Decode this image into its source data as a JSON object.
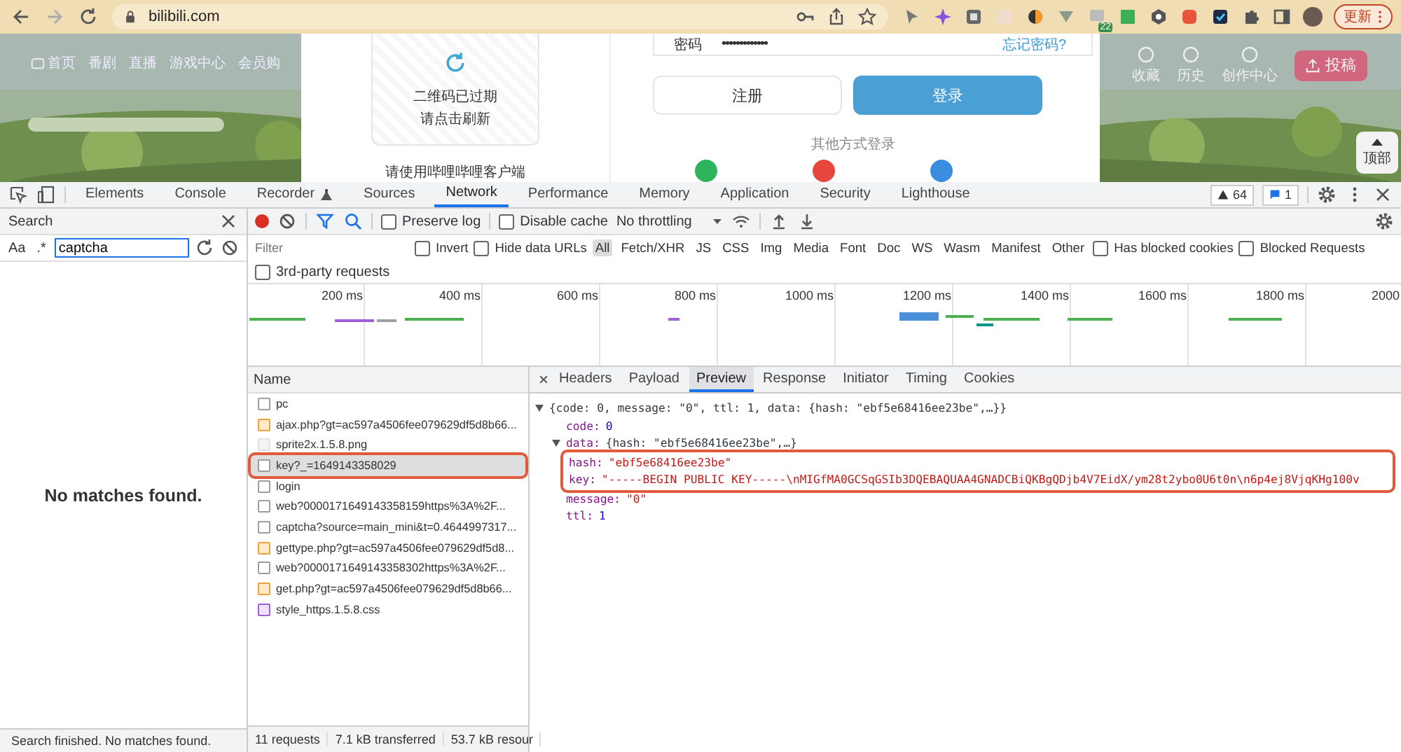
{
  "browser": {
    "url": "bilibili.com",
    "extension_badge": "22",
    "update_button": "更新"
  },
  "page": {
    "nav_left": [
      "首页",
      "番剧",
      "直播",
      "游戏中心",
      "会员购"
    ],
    "nav_right": [
      "收藏",
      "历史",
      "创作中心"
    ],
    "upload_button": "投稿",
    "top_button": "顶部",
    "login": {
      "qr_status": "二维码已过期",
      "qr_hint": "请点击刷新",
      "client_hint": "请使用哔哩哔哩客户端",
      "password_label": "密码",
      "password_value": "•••••••••••••",
      "forgot_link": "忘记密码?",
      "register_button": "注册",
      "login_button": "登录",
      "other_methods": "其他方式登录"
    }
  },
  "devtools": {
    "tabs": [
      {
        "label": "Elements",
        "selected": false
      },
      {
        "label": "Console",
        "selected": false
      },
      {
        "label": "Recorder",
        "selected": false
      },
      {
        "label": "Sources",
        "selected": false
      },
      {
        "label": "Network",
        "selected": true
      },
      {
        "label": "Performance",
        "selected": false
      },
      {
        "label": "Memory",
        "selected": false
      },
      {
        "label": "Application",
        "selected": false
      },
      {
        "label": "Security",
        "selected": false
      },
      {
        "label": "Lighthouse",
        "selected": false
      }
    ],
    "warnings": "64",
    "messages": "1",
    "search": {
      "title": "Search",
      "match_case": "Aa",
      "regex": ".*",
      "query": "captcha",
      "empty_text": "No matches found.",
      "status": "Search finished.  No matches found."
    },
    "network": {
      "recording": true,
      "preserve_log": {
        "label": "Preserve log",
        "checked": false
      },
      "disable_cache": {
        "label": "Disable cache",
        "checked": false
      },
      "throttling": "No throttling",
      "filter": {
        "placeholder": "Filter"
      },
      "invert": {
        "label": "Invert",
        "checked": false
      },
      "hide_data_urls": {
        "label": "Hide data URLs",
        "checked": false
      },
      "types": [
        {
          "label": "All",
          "selected": true
        },
        {
          "label": "Fetch/XHR",
          "selected": false
        },
        {
          "label": "JS",
          "selected": false
        },
        {
          "label": "CSS",
          "selected": false
        },
        {
          "label": "Img",
          "selected": false
        },
        {
          "label": "Media",
          "selected": false
        },
        {
          "label": "Font",
          "selected": false
        },
        {
          "label": "Doc",
          "selected": false
        },
        {
          "label": "WS",
          "selected": false
        },
        {
          "label": "Wasm",
          "selected": false
        },
        {
          "label": "Manifest",
          "selected": false
        },
        {
          "label": "Other",
          "selected": false
        }
      ],
      "has_blocked_cookies": {
        "label": "Has blocked cookies",
        "checked": false
      },
      "blocked_requests": {
        "label": "Blocked Requests",
        "checked": false
      },
      "third_party": {
        "label": "3rd-party requests",
        "checked": false
      },
      "timeline_ticks": [
        "200 ms",
        "400 ms",
        "600 ms",
        "800 ms",
        "1000 ms",
        "1200 ms",
        "1400 ms",
        "1600 ms",
        "1800 ms",
        "2000"
      ],
      "name_column": "Name",
      "requests": [
        {
          "name": "pc",
          "kind": "document",
          "selected": false,
          "outlined": false
        },
        {
          "name": "ajax.php?gt=ac597a4506fee079629df5d8b66...",
          "kind": "script",
          "selected": false,
          "outlined": false
        },
        {
          "name": "sprite2x.1.5.8.png",
          "selected": false,
          "outlined": false
        },
        {
          "name": "key?_=1649143358029",
          "kind": "document",
          "selected": true,
          "outlined": true
        },
        {
          "name": "login",
          "kind": "document",
          "selected": false,
          "outlined": false
        },
        {
          "name": "web?0000171649143358159https%3A%2F...",
          "kind": "document",
          "selected": false,
          "outlined": false
        },
        {
          "name": "captcha?source=main_mini&t=0.4644997317...",
          "kind": "document",
          "selected": false,
          "outlined": false
        },
        {
          "name": "gettype.php?gt=ac597a4506fee079629df5d8...",
          "kind": "script",
          "selected": false,
          "outlined": false
        },
        {
          "name": "web?0000171649143358302https%3A%2F...",
          "kind": "document",
          "selected": false,
          "outlined": false
        },
        {
          "name": "get.php?gt=ac597a4506fee079629df5d8b66...",
          "kind": "script",
          "selected": false,
          "outlined": false
        },
        {
          "name": "style_https.1.5.8.css",
          "kind": "stylesheet",
          "selected": false,
          "outlined": false
        }
      ],
      "detail_tabs": [
        {
          "label": "Headers",
          "selected": false
        },
        {
          "label": "Payload",
          "selected": false
        },
        {
          "label": "Preview",
          "selected": true
        },
        {
          "label": "Response",
          "selected": false
        },
        {
          "label": "Initiator",
          "selected": false
        },
        {
          "label": "Timing",
          "selected": false
        },
        {
          "label": "Cookies",
          "selected": false
        }
      ],
      "preview": {
        "summary": "{code: 0, message: \"0\", ttl: 1, data: {hash: \"ebf5e68416ee23be\",…}}",
        "expanded": true,
        "children": [
          {
            "key": "code:",
            "value": "0",
            "kind": "number"
          },
          {
            "key": "data:",
            "value": "{hash: \"ebf5e68416ee23be\",…}",
            "kind": "object",
            "expanded": true,
            "outlined": true,
            "children": [
              {
                "key": "hash:",
                "value": "\"ebf5e68416ee23be\"",
                "kind": "string"
              },
              {
                "key": "key:",
                "value": "\"-----BEGIN PUBLIC KEY-----\\nMIGfMA0GCSqGSIb3DQEBAQUAA4GNADCBiQKBgQDjb4V7EidX/ym28t2ybo0U6t0n\\n6p4ej8VjqKHg100v",
                "kind": "string"
              }
            ]
          },
          {
            "key": "message:",
            "value": "\"0\"",
            "kind": "string"
          },
          {
            "key": "ttl:",
            "value": "1",
            "kind": "number"
          }
        ]
      },
      "status": [
        "11 requests",
        "7.1 kB transferred",
        "53.7 kB resour"
      ]
    }
  }
}
